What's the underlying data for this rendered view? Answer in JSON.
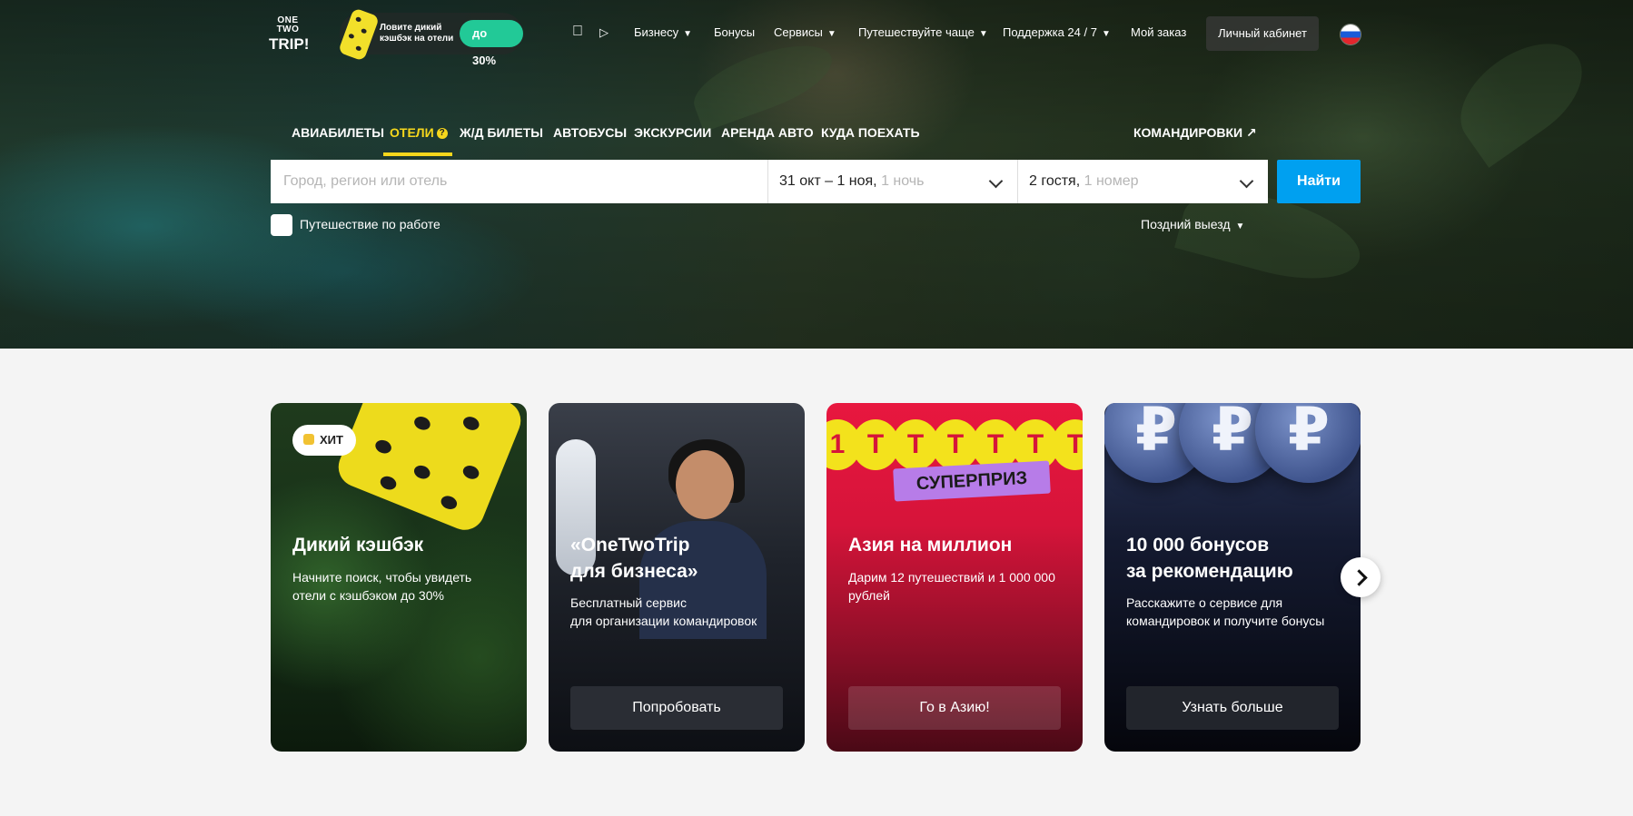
{
  "logo": {
    "line1": "ONE TWO",
    "line2": "TRIP!"
  },
  "promo": {
    "text": "Ловите дикий кэшбэк на отели",
    "badge": "до 30%"
  },
  "apps": {
    "apple": "apple-icon",
    "google_play": "google-play-icon"
  },
  "nav": {
    "business": "Бизнесу",
    "bonuses": "Бонусы",
    "services": "Сервисы",
    "travel_more": "Путешествуйте чаще",
    "support": "Поддержка 24 / 7",
    "my_order": "Мой заказ",
    "account": "Личный кабинет",
    "chevron": "⌄",
    "language": "ru"
  },
  "tabs": {
    "flights": "АВИАБИЛЕТЫ",
    "hotels": "ОТЕЛИ",
    "hotels_tip": "?",
    "rail": "Ж/Д БИЛЕТЫ",
    "buses": "АВТОБУСЫ",
    "excursions": "ЭКСКУРСИИ",
    "car_rental": "АРЕНДА АВТО",
    "where_to_go": "КУДА ПОЕХАТЬ",
    "business_trips": "КОМАНДИРОВКИ",
    "business_trips_arrow": "↗",
    "active": "hotels"
  },
  "search": {
    "destination_placeholder": "Город, регион или отель",
    "destination_value": "",
    "dates": "31 окт – 1 ноя, ",
    "nights": "1 ночь",
    "guests": "2 гостя, ",
    "rooms": "1 номер",
    "find": "Найти"
  },
  "options": {
    "work_trip": "Путешествие по работе",
    "work_trip_checked": false,
    "late_checkout": "Поздний выезд"
  },
  "cards": [
    {
      "badge": "ХИТ",
      "title": "Дикий кэшбэк",
      "text": "Начните поиск, чтобы увидеть отели с кэшбэком до 30%"
    },
    {
      "title_line1": "«OneTwoTrip",
      "title_line2": "для бизнеса»",
      "text_line1": "Бесплатный сервис",
      "text_line2": "для организации командировок",
      "button": "Попробовать"
    },
    {
      "coins": [
        "1",
        "Т",
        "Т",
        "Т",
        "Т",
        "Т",
        "Т"
      ],
      "sticker": "СУПЕРПРИЗ",
      "title": "Азия на миллион",
      "text": "Дарим 12 путешествий и 1 000 000 рублей",
      "button": "Го в Азию!"
    },
    {
      "coins": [
        "₽",
        "₽",
        "₽"
      ],
      "title_line1": "10 000 бонусов",
      "title_line2": "за рекомендацию",
      "text": "Расскажите о сервисе для командировок и получите бонусы",
      "button": "Узнать больше"
    }
  ],
  "colors": {
    "accent": "#00a0f0",
    "active_tab": "#f6d71c",
    "promo_badge": "#22c997"
  }
}
